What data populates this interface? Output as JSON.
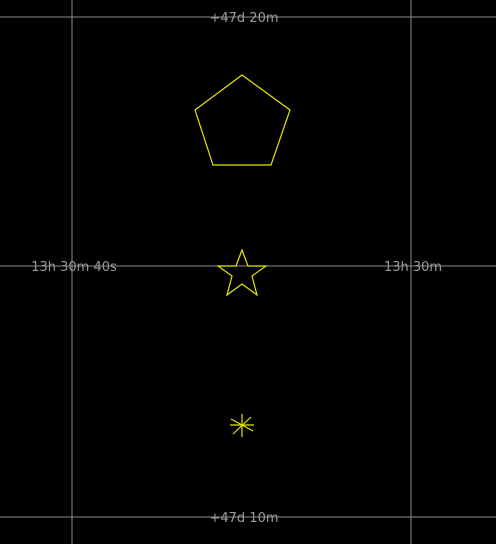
{
  "colors": {
    "background": "#000000",
    "grid": "#8c8c8c",
    "grid_label": "#9a9a9a",
    "markers": "#e6e600"
  },
  "grid_labels": {
    "dec_top": "+47d 20m",
    "dec_bottom": "+47d 10m",
    "ra_left": "13h 30m 40s",
    "ra_right": "13h 30m"
  },
  "markers": [
    {
      "shape": "pentagon",
      "icon": "pentagon-marker-icon"
    },
    {
      "shape": "star",
      "icon": "star-marker-icon"
    },
    {
      "shape": "asterisk",
      "icon": "asterisk-marker-icon"
    }
  ]
}
